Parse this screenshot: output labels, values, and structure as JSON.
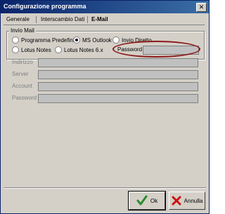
{
  "window": {
    "title": "Configurazione programma",
    "close_glyph": "✕"
  },
  "tabs": [
    {
      "label": "Generale",
      "active": false
    },
    {
      "label": "Interscambio Dati",
      "active": false
    },
    {
      "label": "E-Mail",
      "active": true
    }
  ],
  "invio_mail": {
    "title": "Invio Mail",
    "options": [
      {
        "label": "Programma Predefinito",
        "checked": false
      },
      {
        "label": "MS Outlook",
        "checked": true
      },
      {
        "label": "Invio Diretto",
        "checked": false
      },
      {
        "label": "Lotus Notes",
        "checked": false
      },
      {
        "label": "Lotus Notes 6.x",
        "checked": false
      }
    ],
    "password_label": "Password",
    "password_value": ""
  },
  "fields": [
    {
      "label": "Indirizzo",
      "value": ""
    },
    {
      "label": "Server",
      "value": ""
    },
    {
      "label": "Account",
      "value": ""
    },
    {
      "label": "Password",
      "value": ""
    }
  ],
  "buttons": {
    "ok_label": "Ok",
    "cancel_label": "Annulla",
    "ok_icon": "checkmark-icon",
    "cancel_icon": "red-x-icon"
  },
  "colors": {
    "title_bar": "#0a246a",
    "ok_check": "#2e8b2e",
    "cancel_x": "#cc1111",
    "highlight_ellipse": "#8b1a1a"
  }
}
